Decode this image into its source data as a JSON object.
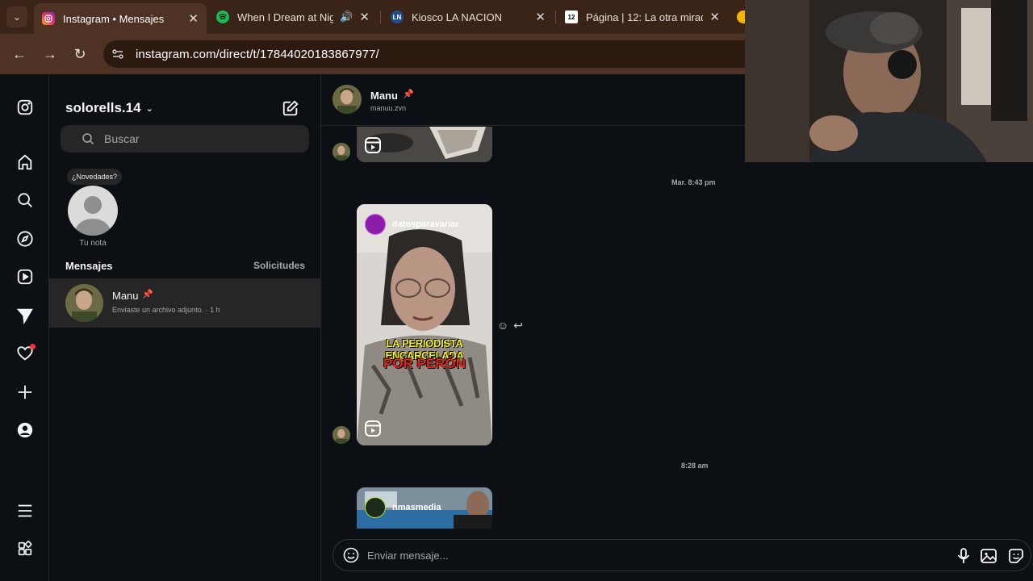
{
  "browser": {
    "tabs": [
      {
        "title": "Instagram • Mensajes",
        "favicon": "instagram-favicon",
        "active": true
      },
      {
        "title": "When I Dream at Nig",
        "favicon": "spotify-favicon",
        "active": false
      },
      {
        "title": "Kiosco LA NACION",
        "favicon": "ln-favicon",
        "favicon_text": "LN",
        "active": false
      },
      {
        "title": "Página | 12: La otra mirad",
        "favicon": "pagina12-favicon",
        "favicon_text": "12",
        "active": false
      }
    ],
    "url": "instagram.com/direct/t/17844020183867977/"
  },
  "inbox": {
    "username": "solorells.14",
    "search_placeholder": "Buscar",
    "note_bubble": "¿Novedades?",
    "note_label": "Tu nota",
    "section_title": "Mensajes",
    "requests_label": "Solicitudes",
    "conversations": [
      {
        "name": "Manu",
        "pinned": true,
        "preview": "Enviaste un archivo adjunto. · 1 h"
      }
    ]
  },
  "thread": {
    "name": "Manu",
    "handle": "manuu.zvn",
    "messages": [
      {
        "type": "reel",
        "timestamp": "Mar. 8:43 pm",
        "account": "datosparavariar",
        "caption_line1": "LA PERIODISTA ENCARCELADA",
        "caption_line2": "POR PERÓN"
      },
      {
        "type": "reel",
        "timestamp": "8:28 am",
        "account": "nmasmedia"
      }
    ],
    "composer_placeholder": "Enviar mensaje..."
  },
  "colors": {
    "background": "#0c1014",
    "panel": "#262626",
    "secondary_text": "#a8a8a8",
    "tab_bar": "#3a2418",
    "notification_dot": "#ff3040"
  }
}
